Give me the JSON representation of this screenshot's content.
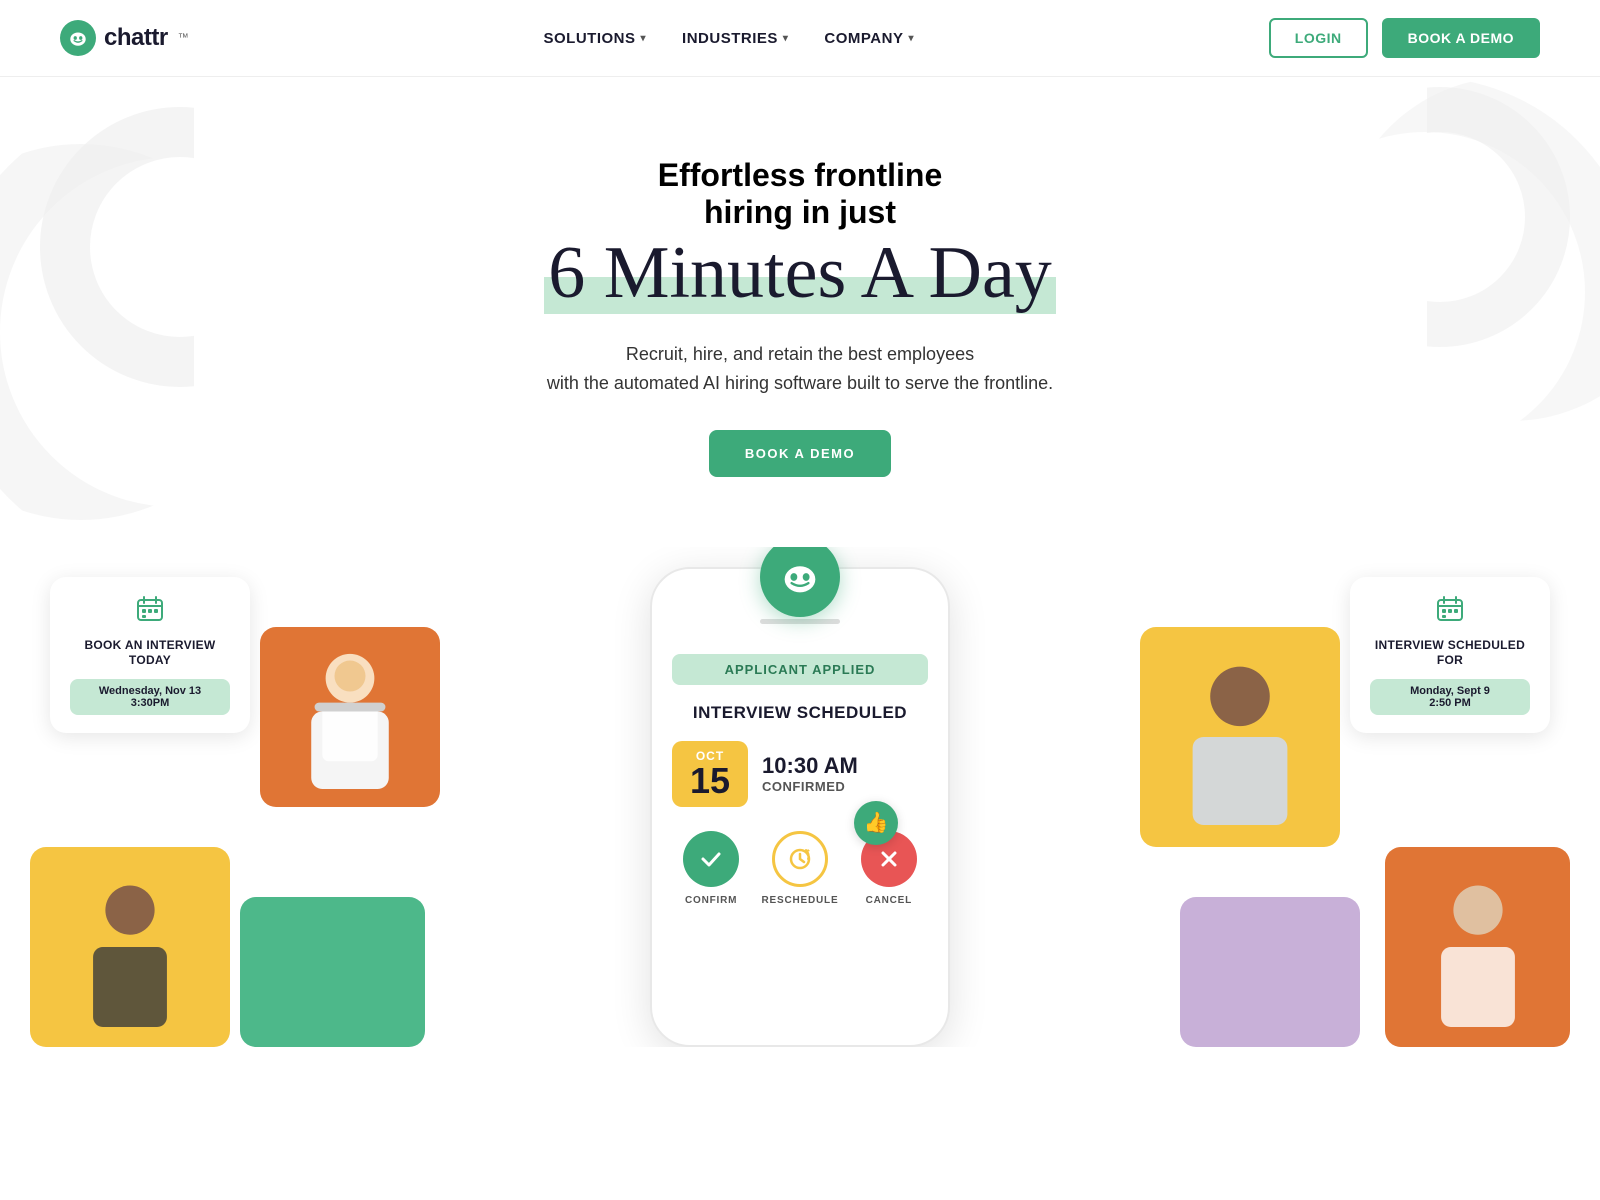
{
  "brand": {
    "name": "chattr",
    "logo_alt": "chattr logo"
  },
  "nav": {
    "links": [
      {
        "label": "SOLUTIONS",
        "has_dropdown": true
      },
      {
        "label": "INDUSTRIES",
        "has_dropdown": true
      },
      {
        "label": "COMPANY",
        "has_dropdown": true
      }
    ],
    "login_label": "LOGIN",
    "book_demo_label": "BOOK A DEMO"
  },
  "hero": {
    "title_line1": "Effortless frontline",
    "title_line2": "hiring in just",
    "title_handwriting": "6 Minutes A Day",
    "subtitle_line1": "Recruit, hire, and retain the best employees",
    "subtitle_line2": "with the automated AI hiring software built to serve the frontline.",
    "cta_label": "BOOK A DEMO"
  },
  "phone": {
    "badge": "APPLICANT APPLIED",
    "interview_title": "INTERVIEW SCHEDULED",
    "date_month": "OCT",
    "date_day": "15",
    "time": "10:30 AM",
    "confirmed": "CONFIRMED",
    "action_confirm": "CONFIRM",
    "action_reschedule": "RESCHEDULE",
    "action_cancel": "CANCEL"
  },
  "cards": {
    "left": {
      "title": "BOOK AN INTERVIEW TODAY",
      "date": "Wednesday, Nov 13",
      "time": "3:30PM"
    },
    "right": {
      "title": "INTERVIEW SCHEDULED FOR",
      "date": "Monday, Sept 9",
      "time": "2:50 PM"
    }
  }
}
